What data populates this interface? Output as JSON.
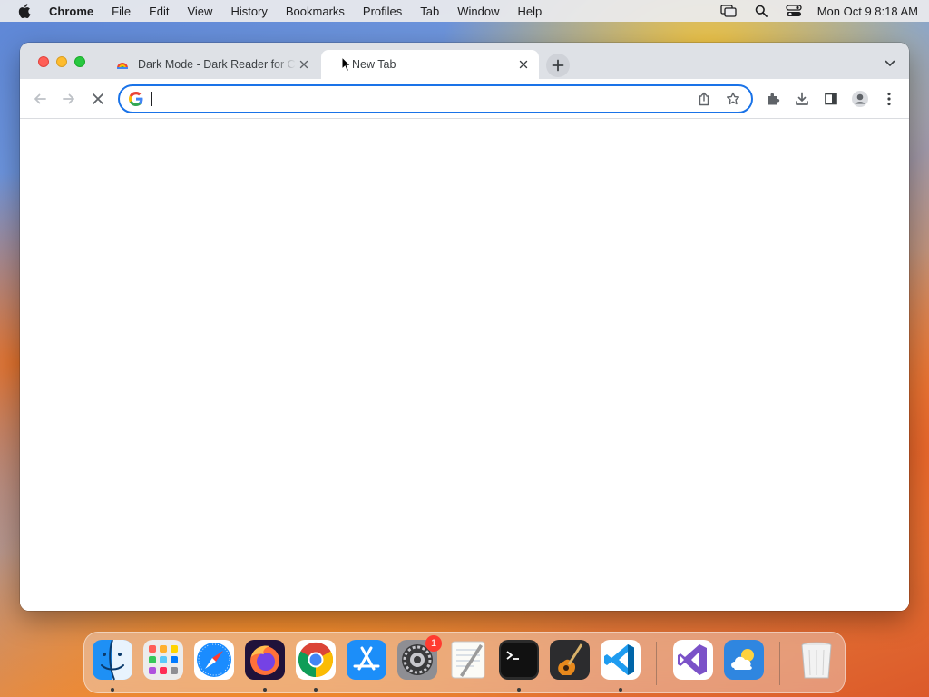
{
  "menubar": {
    "app_name": "Chrome",
    "items": [
      "File",
      "Edit",
      "View",
      "History",
      "Bookmarks",
      "Profiles",
      "Tab",
      "Window",
      "Help"
    ],
    "clock": "Mon Oct 9  8:18 AM"
  },
  "browser": {
    "tabs": [
      {
        "title": "Dark Mode - Dark Reader for Chrome",
        "active": false
      },
      {
        "title": "New Tab",
        "active": true
      }
    ],
    "omnibox": {
      "value": "",
      "placeholder": ""
    }
  },
  "dock": {
    "items": [
      {
        "name": "Finder",
        "icon": "finder-icon",
        "running": true
      },
      {
        "name": "Launchpad",
        "icon": "launchpad-icon",
        "running": false
      },
      {
        "name": "Safari",
        "icon": "safari-icon",
        "running": false
      },
      {
        "name": "Firefox",
        "icon": "firefox-icon",
        "running": true
      },
      {
        "name": "Google Chrome",
        "icon": "chrome-icon",
        "running": true
      },
      {
        "name": "App Store",
        "icon": "app-store-icon",
        "running": false
      },
      {
        "name": "System Settings",
        "icon": "settings-icon",
        "running": false,
        "badge": "1"
      },
      {
        "name": "TextEdit",
        "icon": "textedit-icon",
        "running": false
      },
      {
        "name": "Terminal",
        "icon": "terminal-icon",
        "running": true
      },
      {
        "name": "GarageBand",
        "icon": "garageband-icon",
        "running": false
      },
      {
        "name": "Visual Studio Code",
        "icon": "vscode-icon",
        "running": true
      },
      {
        "name": "Visual Studio",
        "icon": "visual-studio-icon",
        "running": false
      },
      {
        "name": "Weather",
        "icon": "weather-icon",
        "running": false
      },
      {
        "name": "Trash",
        "icon": "trash-icon",
        "running": false
      }
    ]
  },
  "colors": {
    "accent": "#1a73e8",
    "tabstrip": "#dee1e6",
    "close_red": "#ff5f57",
    "minimize_yellow": "#febc2e",
    "zoom_green": "#28c840"
  }
}
